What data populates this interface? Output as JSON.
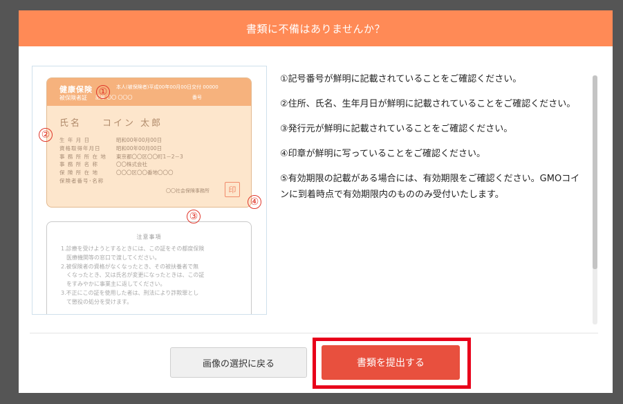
{
  "modal": {
    "title": "書類に不備はありませんか？"
  },
  "sample_card": {
    "title": "健康保険",
    "subtitle": "被保険者証",
    "symbol_label": "記号 〇〇 〇〇〇",
    "number_label": "番号",
    "issued": "本人(被保険者)平成00年00月00日交付  00000",
    "name_label": "氏名",
    "name_value": "コイン 太郎",
    "rows": [
      {
        "k": "生 年 月 日",
        "v": "昭和00年00月00日"
      },
      {
        "k": "資格取得年月日",
        "v": "昭和00年00月00日"
      },
      {
        "k": "事 務 所 所 在 地",
        "v": "東京都〇〇区〇〇町1－2－3"
      },
      {
        "k": "事 務 所 名 称",
        "v": "〇〇株式会社"
      },
      {
        "k": "保 険 所 在 地",
        "v": "〇〇〇区〇〇番地〇〇〇"
      },
      {
        "k": "保険者番号･名称",
        "v": ""
      }
    ],
    "office": "〇〇社会保険事務所",
    "seal": "印",
    "markers": [
      "①",
      "②",
      "③",
      "④"
    ]
  },
  "notes_card": {
    "title": "注意事項",
    "lines": [
      "1.診療を受けようとするときには、この証をその都度保険",
      "　医療機関等の窓口で渡してください。",
      "2.被保険者の資格がなくなったとき、その被扶養者で無",
      "　くなったとき、又は氏名が変更になったときは、この証",
      "　をすみやかに事業主に返してください。",
      "3.不正にこの証を使用した者は、刑法により詐欺罪とし",
      "　て懲役の処分を受けます。"
    ]
  },
  "instructions": [
    "①記号番号が鮮明に記載されていることをご確認ください。",
    "②住所、氏名、生年月日が鮮明に記載されていることをご確認ください。",
    "③発行元が鮮明に記載されていることをご確認ください。",
    "④印章が鮮明に写っていることをご確認ください。",
    "⑤有効期限の記載がある場合には、有効期限をご確認ください。GMOコインに到着時点で有効期限内のもののみ受付いたします。"
  ],
  "footer": {
    "back_label": "画像の選択に戻る",
    "submit_label": "書類を提出する"
  },
  "colors": {
    "header": "#ff8a56",
    "submit": "#e8503e",
    "highlight": "#e8001a"
  }
}
